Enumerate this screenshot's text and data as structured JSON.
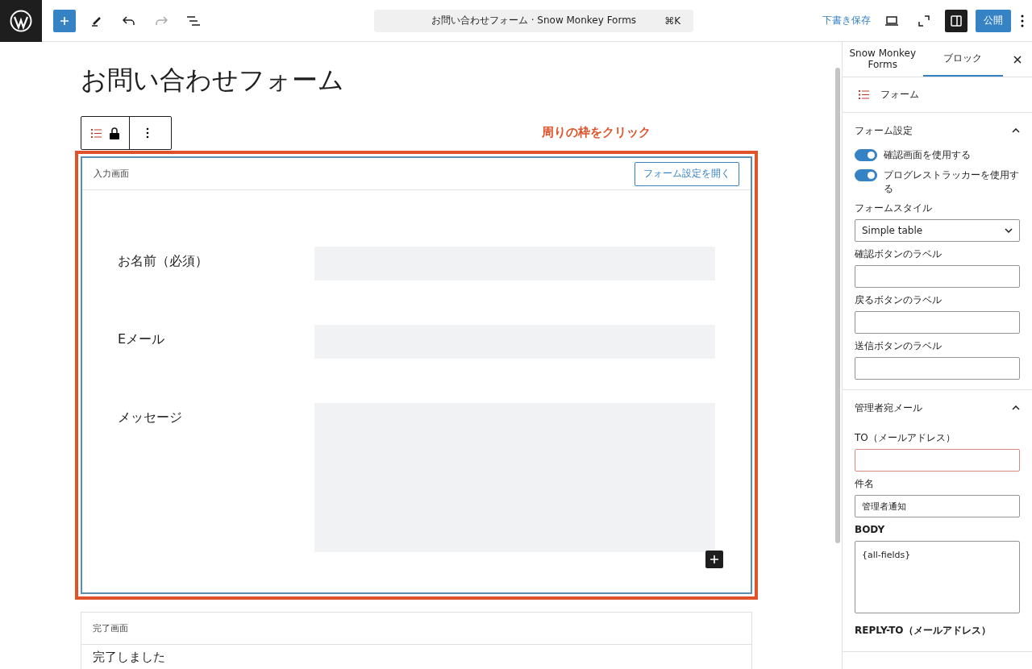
{
  "topbar": {
    "command": "お問い合わせフォーム · Snow Monkey Forms",
    "shortcut": "⌘K",
    "save_draft": "下書き保存",
    "publish": "公開",
    "settings_open": true
  },
  "editor": {
    "title": "お問い合わせフォーム",
    "annotation": "周りの枠をクリック",
    "input_screen": {
      "label": "入力画面",
      "open_settings": "フォーム設定を開く",
      "fields": [
        {
          "label": "お名前（必須）",
          "kind": "text"
        },
        {
          "label": "Eメール",
          "kind": "text"
        },
        {
          "label": "メッセージ",
          "kind": "textarea"
        }
      ]
    },
    "complete_screen": {
      "label": "完了画面",
      "text": "完了しました"
    }
  },
  "sidebar": {
    "tabs": [
      {
        "label": "Snow Monkey Forms",
        "selected": false
      },
      {
        "label": "ブロック",
        "selected": true
      }
    ],
    "block_name": "フォーム",
    "panels": [
      {
        "title": "フォーム設定",
        "expanded": true,
        "controls": [
          {
            "kind": "toggle",
            "label": "確認画面を使用する",
            "on": true
          },
          {
            "kind": "toggle",
            "label": "プログレストラッカーを使用する",
            "on": true
          },
          {
            "kind": "select",
            "label": "フォームスタイル",
            "value": "Simple table"
          },
          {
            "kind": "input",
            "label": "確認ボタンのラベル",
            "error": false
          },
          {
            "kind": "input",
            "label": "戻るボタンのラベル",
            "error": false
          },
          {
            "kind": "input",
            "label": "送信ボタンのラベル",
            "error": false
          }
        ]
      },
      {
        "title": "管理者宛メール",
        "expanded": true,
        "controls": [
          {
            "kind": "input",
            "label": "TO（メールアドレス）",
            "error": true
          },
          {
            "kind": "input",
            "label": "件名",
            "value": "管理者通知",
            "error": false
          },
          {
            "kind": "textarea",
            "label": "BODY",
            "value": "{all-fields}"
          },
          {
            "kind": "label",
            "label": "REPLY-TO（メールアドレス）"
          }
        ]
      }
    ]
  }
}
